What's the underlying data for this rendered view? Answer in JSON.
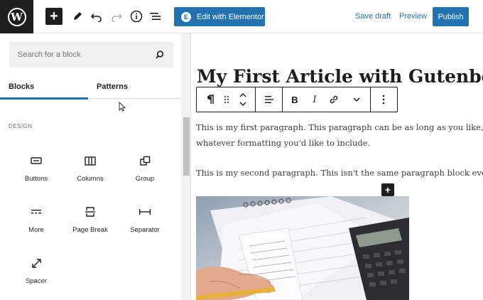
{
  "toolbar": {
    "logo": "W",
    "elementor_label": "Edit with Elementor",
    "elementor_icon_text": "E",
    "save_draft_label": "Save draft",
    "preview_label": "Preview",
    "publish_label": "Publish",
    "icons": [
      "add-block-icon",
      "edit-tools-icon",
      "undo-icon",
      "redo-icon",
      "details-info-icon",
      "list-view-icon"
    ]
  },
  "sidebar": {
    "search_placeholder": "Search for a block",
    "tabs": [
      {
        "label": "Blocks",
        "active": true
      },
      {
        "label": "Patterns",
        "active": false
      }
    ],
    "section_label": "DESIGN",
    "blocks": [
      {
        "label": "Buttons",
        "icon": "buttons-icon"
      },
      {
        "label": "Columns",
        "icon": "columns-icon"
      },
      {
        "label": "Group",
        "icon": "group-icon"
      },
      {
        "label": "More",
        "icon": "more-icon"
      },
      {
        "label": "Page Break",
        "icon": "page-break-icon"
      },
      {
        "label": "Separator",
        "icon": "separator-icon"
      },
      {
        "label": "Spacer",
        "icon": "spacer-icon"
      }
    ]
  },
  "editor": {
    "title": "My First Article with Gutenberg",
    "paragraphs": [
      "This is my first paragraph. This paragraph can be as long as you like, including",
      "whatever formatting you'd like to include.",
      "This is my second paragraph. This isn't the same paragraph block even though"
    ],
    "block_toolbar": [
      "paragraph-icon",
      "drag-handle-icon",
      "move-up-down-icon",
      "align-icon",
      "bold-icon",
      "italic-icon",
      "link-icon",
      "more-options-chevron-icon",
      "options-kebab-icon"
    ],
    "bold_label": "B",
    "italic_label": "I",
    "image_alt": "Hand holding a pencil over receipts, paperwork and a calculator"
  },
  "colors": {
    "accent": "#2271b1",
    "dark": "#1e1e1e",
    "panel": "#f0f0f0"
  }
}
